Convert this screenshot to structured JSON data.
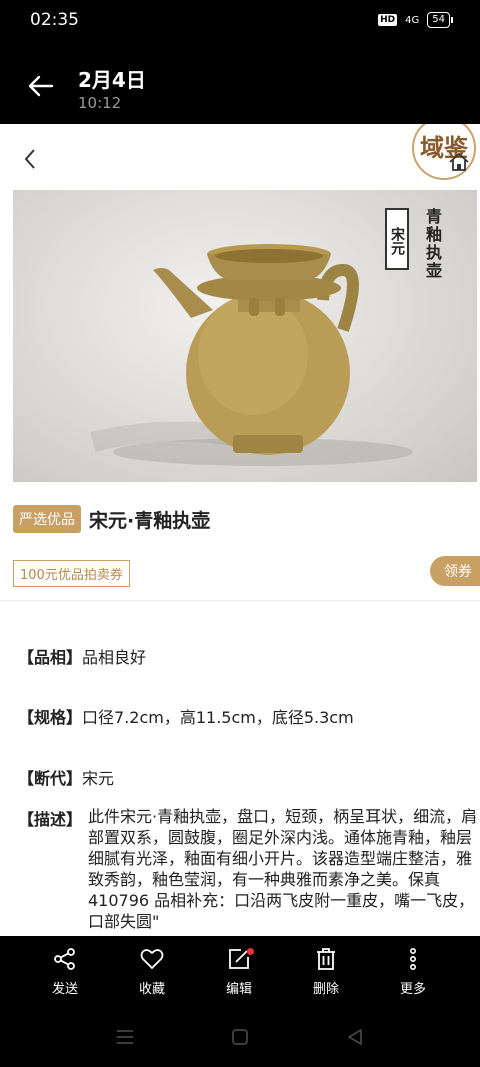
{
  "status": {
    "time": "02:35",
    "hd": "HD",
    "network": "4G",
    "battery": "54"
  },
  "header": {
    "date": "2月4日",
    "time": "10:12"
  },
  "logo": {
    "text": "域鉴"
  },
  "image": {
    "badge": "宋元",
    "side_title": "青釉执壶"
  },
  "product": {
    "tag": "严选优品",
    "title": "宋元·青釉执壶",
    "coupon": "100元优品拍卖券",
    "coupon_button": "领券"
  },
  "specs": [
    {
      "key": "【品相】",
      "value": "品相良好"
    },
    {
      "key": "【规格】",
      "value": "口径7.2cm，高11.5cm，底径5.3cm"
    },
    {
      "key": "【断代】",
      "value": "宋元"
    }
  ],
  "description": {
    "key": "【描述】",
    "value": "此件宋元·青釉执壶，盘口，短颈，柄呈耳状，细流，肩部置双系，圆鼓腹，圈足外深内浅。通体施青釉，釉层细腻有光泽，釉面有细小开片。该器造型端庄整洁，雅致秀韵，釉色莹润，有一种典雅而素净之美。保真410796 品相补充：口沿两飞皮附一重皮，嘴一飞皮，口部失圆\""
  },
  "toolbar": {
    "send": "发送",
    "favorite": "收藏",
    "edit": "编辑",
    "delete": "删除",
    "more": "更多"
  }
}
